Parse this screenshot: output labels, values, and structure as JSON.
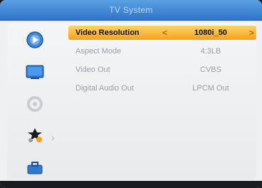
{
  "header": {
    "title": "TV System"
  },
  "sidebar": {
    "items": [
      {
        "name": "media-icon"
      },
      {
        "name": "picture-icon"
      },
      {
        "name": "settings-icon"
      },
      {
        "name": "tv-system-icon"
      },
      {
        "name": "tools-icon"
      }
    ]
  },
  "menu": {
    "rows": [
      {
        "label": "Video Resolution",
        "value": "1080i_50",
        "selected": true
      },
      {
        "label": "Aspect Mode",
        "value": "4:3LB",
        "selected": false
      },
      {
        "label": "Video Out",
        "value": "CVBS",
        "selected": false
      },
      {
        "label": "Digital Audio Out",
        "value": "LPCM Out",
        "selected": false
      }
    ],
    "left_arrow": "<",
    "right_arrow": ">"
  },
  "colors": {
    "title_bar": "#2f74c7",
    "highlight": "#f2a21b",
    "text_inactive": "#9aa0a6"
  }
}
